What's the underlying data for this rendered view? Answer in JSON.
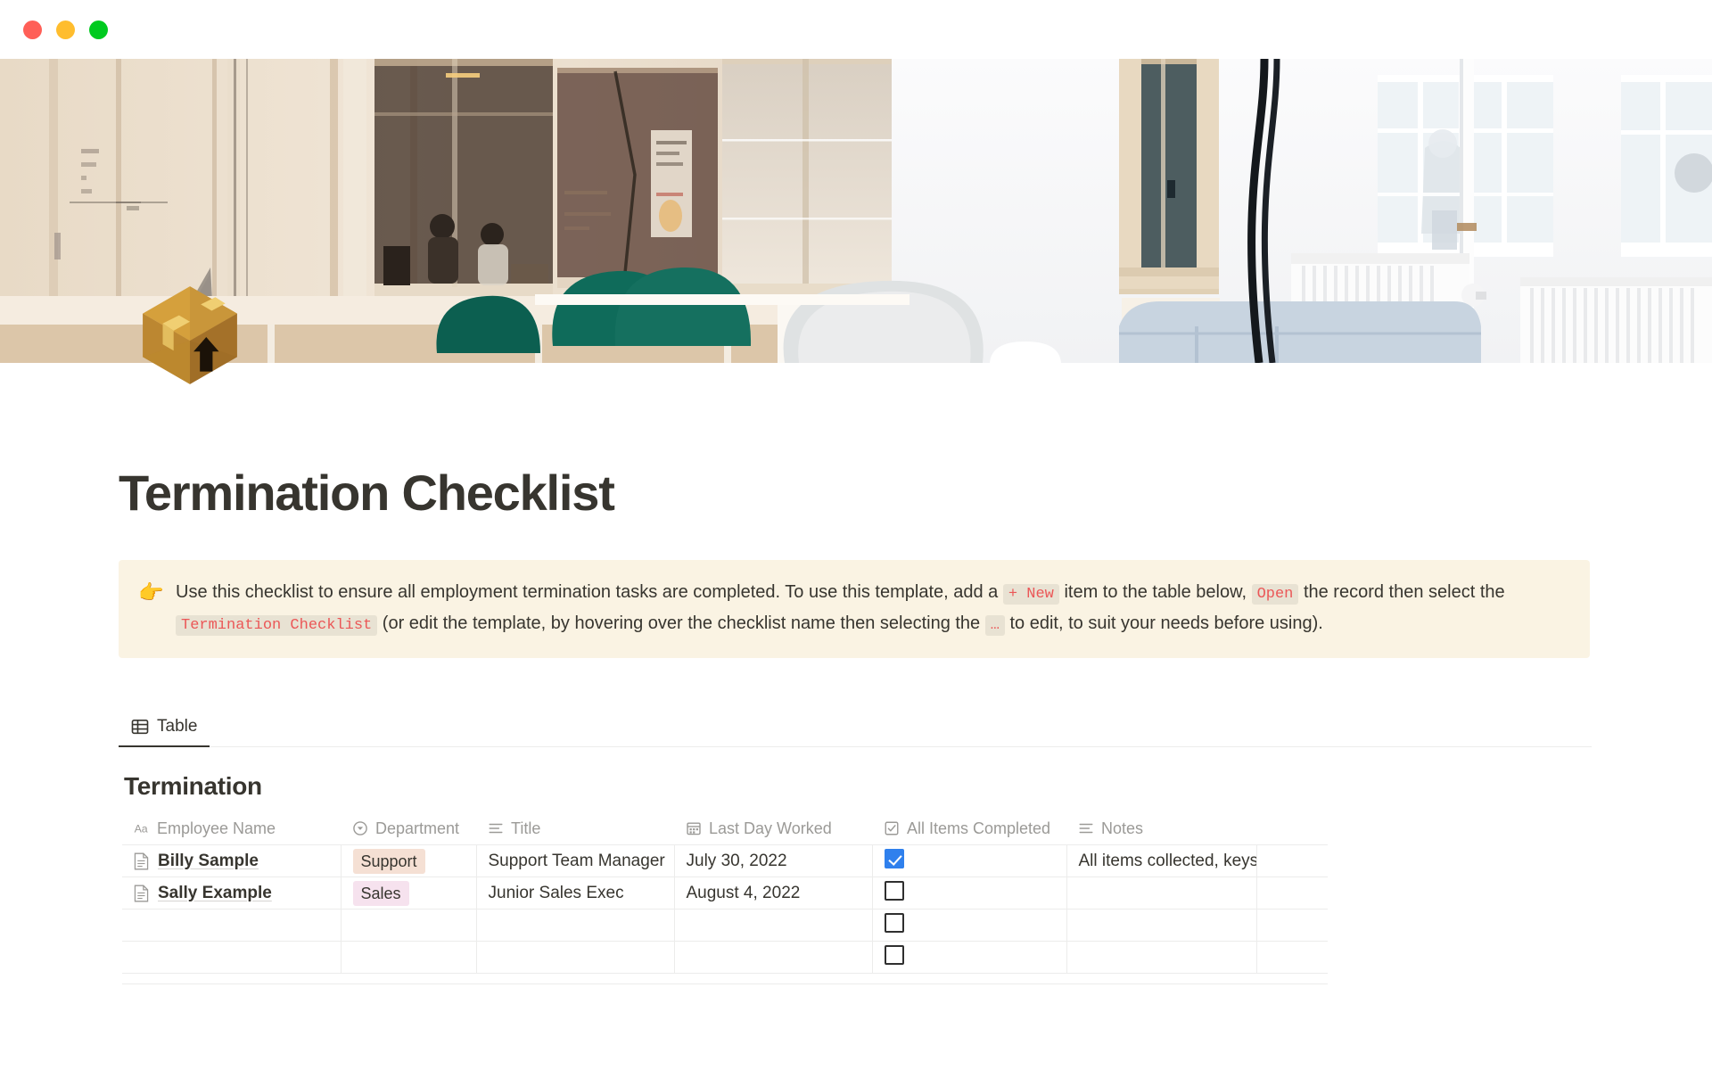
{
  "window": {
    "traffic_lights": [
      {
        "name": "close",
        "color": "#ff5f57"
      },
      {
        "name": "minimize",
        "color": "#ffbd2e"
      },
      {
        "name": "maximize",
        "color": "#00ca1f"
      }
    ]
  },
  "cover": {
    "alt": "office interior with green and grey chairs, large windows and radiators"
  },
  "page": {
    "icon": "package-box-emoji",
    "title": "Termination Checklist"
  },
  "callout": {
    "emoji": "👉",
    "segments": [
      {
        "type": "text",
        "value": "Use this checklist to ensure all employment termination tasks are completed. To use this template, add a "
      },
      {
        "type": "code",
        "value": "+ New"
      },
      {
        "type": "text",
        "value": " item to the table below, "
      },
      {
        "type": "code",
        "value": "Open"
      },
      {
        "type": "text",
        "value": " the record then select the "
      },
      {
        "type": "code",
        "value": "Termination Checklist"
      },
      {
        "type": "text",
        "value": " (or edit the template, by hovering over the checklist name then selecting the "
      },
      {
        "type": "code",
        "value": "…"
      },
      {
        "type": "text",
        "value": " to edit, to suit your needs before using)."
      }
    ],
    "background": "#faf3e3",
    "code_color": "#eb5757"
  },
  "view_tabs": [
    {
      "label": "Table",
      "icon": "table-icon",
      "active": true
    }
  ],
  "database": {
    "title": "Termination",
    "columns": [
      {
        "label": "Employee Name",
        "icon": "text-type-icon"
      },
      {
        "label": "Department",
        "icon": "select-type-icon"
      },
      {
        "label": "Title",
        "icon": "richtext-type-icon"
      },
      {
        "label": "Last Day Worked",
        "icon": "date-type-icon"
      },
      {
        "label": "All Items Completed",
        "icon": "checkbox-type-icon"
      },
      {
        "label": "Notes",
        "icon": "richtext-type-icon"
      }
    ],
    "rows": [
      {
        "employee_name": "Billy Sample",
        "department": "Support",
        "department_color": "#f5e0d4",
        "title": "Support Team Manager",
        "last_day_worked": "July 30, 2022",
        "all_items_completed": true,
        "notes": "All items collected, keys given to Stacey"
      },
      {
        "employee_name": "Sally Example",
        "department": "Sales",
        "department_color": "#f6e2ee",
        "title": "Junior Sales Exec",
        "last_day_worked": "August 4, 2022",
        "all_items_completed": false,
        "notes": ""
      },
      {
        "employee_name": "",
        "department": "",
        "department_color": "",
        "title": "",
        "last_day_worked": "",
        "all_items_completed": false,
        "notes": ""
      },
      {
        "employee_name": "",
        "department": "",
        "department_color": "",
        "title": "",
        "last_day_worked": "",
        "all_items_completed": false,
        "notes": ""
      }
    ]
  }
}
